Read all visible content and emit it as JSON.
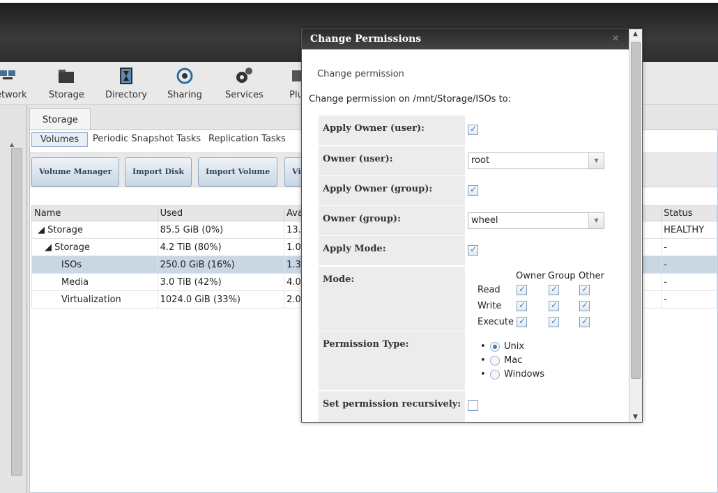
{
  "toolbar": {
    "items": [
      {
        "label": "etwork",
        "icon": "network-icon"
      },
      {
        "label": "Storage",
        "icon": "storage-icon"
      },
      {
        "label": "Directory",
        "icon": "directory-icon"
      },
      {
        "label": "Sharing",
        "icon": "sharing-icon"
      },
      {
        "label": "Services",
        "icon": "services-icon"
      },
      {
        "label": "Plu",
        "icon": "plugins-icon"
      }
    ]
  },
  "main": {
    "tab": "Storage",
    "subtabs": [
      "Volumes",
      "Periodic Snapshot Tasks",
      "Replication Tasks"
    ],
    "buttons": [
      "Volume Manager",
      "Import Disk",
      "Import Volume",
      "Vi"
    ],
    "table": {
      "headers": [
        "Name",
        "Used",
        "Ava",
        "Status"
      ],
      "rows": [
        {
          "name": "◢ Storage",
          "used": "85.5 GiB (0%)",
          "avail": "13.",
          "status": "HEALTHY"
        },
        {
          "name": "◢ Storage",
          "used": "4.2 TiB (80%)",
          "avail": "1.0",
          "status": "-"
        },
        {
          "name": "ISOs",
          "used": "250.0 GiB (16%)",
          "avail": "1.3",
          "status": "-"
        },
        {
          "name": "Media",
          "used": "3.0 TiB (42%)",
          "avail": "4.0",
          "status": "-"
        },
        {
          "name": "Virtualization",
          "used": "1024.0 GiB (33%)",
          "avail": "2.0",
          "status": "-"
        }
      ]
    }
  },
  "dialog": {
    "title": "Change Permissions",
    "close": "✕",
    "heading": "Change permission",
    "intro": "Change permission on /mnt/Storage/ISOs to:",
    "apply_owner_user": {
      "label": "Apply Owner (user):",
      "checked": true
    },
    "owner_user": {
      "label": "Owner (user):",
      "value": "root"
    },
    "apply_owner_group": {
      "label": "Apply Owner (group):",
      "checked": true
    },
    "owner_group": {
      "label": "Owner (group):",
      "value": "wheel"
    },
    "apply_mode": {
      "label": "Apply Mode:",
      "checked": true
    },
    "mode": {
      "label": "Mode:",
      "columns": [
        "Owner",
        "Group",
        "Other"
      ],
      "rows": [
        "Read",
        "Write",
        "Execute"
      ]
    },
    "permission_type": {
      "label": "Permission Type:",
      "options": [
        "Unix",
        "Mac",
        "Windows"
      ],
      "selected": "Unix"
    },
    "recursive": {
      "label": "Set permission recursively:",
      "checked": false
    }
  },
  "colors": {
    "accent": "#4a78a8",
    "selected_row": "#c9d6e4",
    "title_bar": "#2b2b2b"
  }
}
